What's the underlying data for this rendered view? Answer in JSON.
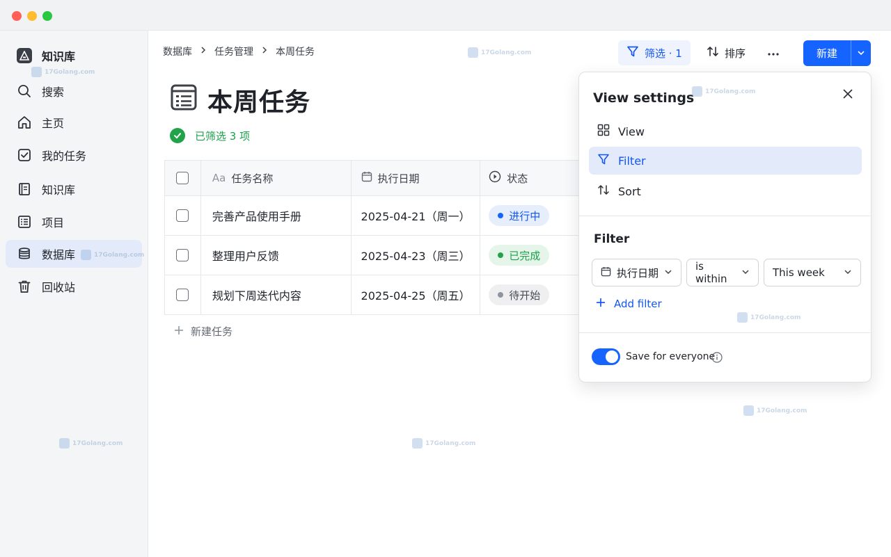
{
  "sidebar": {
    "workspace": "知识库",
    "items": [
      {
        "label": "搜索",
        "icon": "search-icon"
      },
      {
        "label": "主页",
        "icon": "home-icon"
      },
      {
        "label": "我的任务",
        "icon": "checkbox-icon"
      },
      {
        "label": "知识库",
        "icon": "book-icon"
      },
      {
        "label": "项目",
        "icon": "list-icon"
      },
      {
        "label": "数据库",
        "icon": "database-icon",
        "active": true
      },
      {
        "label": "回收站",
        "icon": "trash-icon"
      }
    ]
  },
  "breadcrumb": [
    "数据库",
    "任务管理",
    "本周任务"
  ],
  "toolbar": {
    "filter_label": "筛选 · 1",
    "sort_label": "排序",
    "new_label": "新建"
  },
  "page": {
    "title": "本周任务",
    "filtered_text": "已筛选 3 项"
  },
  "table": {
    "headers": {
      "name": "任务名称",
      "date": "执行日期",
      "status": "状态",
      "name_prefix": "Aa"
    },
    "rows": [
      {
        "name": "完善产品使用手册",
        "date": "2025-04-21（周一）",
        "status": "进行中",
        "status_color": "#1664ff"
      },
      {
        "name": "整理用户反馈",
        "date": "2025-04-23（周三）",
        "status": "已完成",
        "status_color": "#22a34a"
      },
      {
        "name": "规划下周迭代内容",
        "date": "2025-04-25（周五）",
        "status": "待开始",
        "status_color": "#8f959e"
      }
    ],
    "new_task_label": "新建任务"
  },
  "popover": {
    "title": "View settings",
    "items": [
      {
        "label": "View",
        "icon": "grid-icon"
      },
      {
        "label": "Filter",
        "icon": "filter-icon",
        "active": true
      },
      {
        "label": "Sort",
        "icon": "sort-icon"
      }
    ],
    "filter_heading": "Filter",
    "filter": {
      "field": "执行日期",
      "operator": "is within",
      "value": "This week"
    },
    "add_filter_label": "Add filter",
    "save_label": "Save for everyone",
    "save_enabled": true
  },
  "watermark": "17Golang.com",
  "colors": {
    "accent": "#1664ff",
    "success": "#22a34a",
    "muted": "#8f959e"
  }
}
